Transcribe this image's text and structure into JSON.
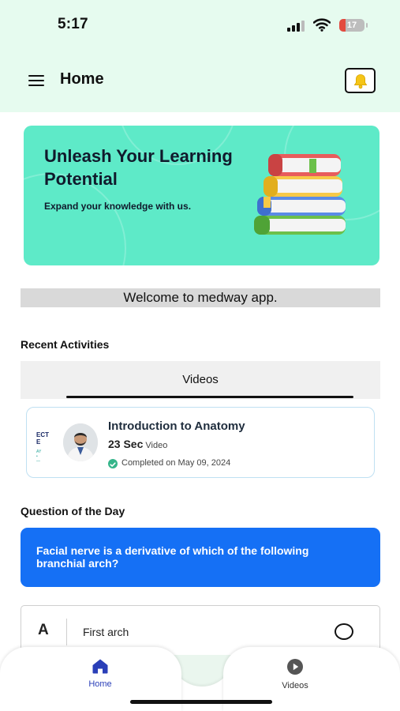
{
  "status_bar": {
    "time": "5:17",
    "battery": "17"
  },
  "header": {
    "title": "Home"
  },
  "banner": {
    "title": "Unleash Your Learning Potential",
    "subtitle": "Expand your knowledge with us."
  },
  "welcome": "Welcome to medway app.",
  "recent": {
    "heading": "Recent Activities",
    "tab": "Videos",
    "item": {
      "title": "Introduction to Anatomy",
      "duration": "23 Sec",
      "type": "Video",
      "status": "Completed on May 09, 2024",
      "thumb_text": "ECT\nE",
      "thumb_sub": "AY\n•\n—"
    }
  },
  "qotd": {
    "heading": "Question of the Day",
    "question": "Facial nerve is a derivative of which of the following branchial arch?",
    "options": [
      {
        "letter": "A",
        "text": "First arch"
      }
    ]
  },
  "nav": {
    "home": "Home",
    "videos": "Videos"
  },
  "colors": {
    "accent": "#1570f5",
    "header_bg": "#e6fbef",
    "banner_bg": "#5eeac8",
    "nav_active": "#2a3fb8",
    "bell": "#f5c518"
  },
  "icons": {
    "menu": "hamburger-icon",
    "bell": "bell-icon",
    "home": "home-icon",
    "videos": "play-circle-icon",
    "check": "check-circle-icon"
  }
}
